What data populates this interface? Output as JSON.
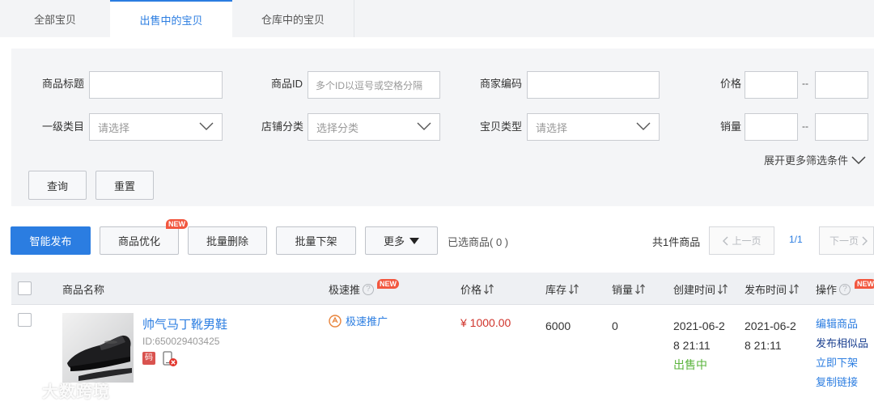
{
  "tabs": [
    {
      "label": "全部宝贝"
    },
    {
      "label": "出售中的宝贝"
    },
    {
      "label": "仓库中的宝贝"
    }
  ],
  "filters": {
    "title_label": "商品标题",
    "id_label": "商品ID",
    "id_placeholder": "多个ID以逗号或空格分隔",
    "merchant_code_label": "商家编码",
    "price_label": "价格",
    "category_label": "一级类目",
    "category_placeholder": "请选择",
    "shop_category_label": "店铺分类",
    "shop_category_placeholder": "选择分类",
    "item_type_label": "宝贝类型",
    "item_type_placeholder": "请选择",
    "sales_label": "销量",
    "range_sep": "--",
    "expand_label": "展开更多筛选条件",
    "query_button": "查询",
    "reset_button": "重置"
  },
  "actions": {
    "smart_publish": "智能发布",
    "optimize": "商品优化",
    "new_badge": "NEW",
    "batch_delete": "批量删除",
    "batch_offline": "批量下架",
    "more": "更多",
    "selected": "已选商品( 0 )",
    "total": "共1件商品",
    "prev": "上一页",
    "page": "1/1",
    "next": "下一页"
  },
  "table": {
    "headers": {
      "name": "商品名称",
      "promo": "极速推",
      "price": "价格",
      "stock": "库存",
      "sales": "销量",
      "created": "创建时间",
      "published": "发布时间",
      "ops": "操作",
      "new_badge": "NEW"
    },
    "rows": [
      {
        "name": "帅气马丁靴男鞋",
        "id": "ID:650029403425",
        "code_tag": "码",
        "promo": "极速推广",
        "price": "¥ 1000.00",
        "stock": "6000",
        "sales": "0",
        "created_line1": "2021-06-2",
        "created_line2": "8 21:11",
        "status": "出售中",
        "published_line1": "2021-06-2",
        "published_line2": "8 21:11",
        "ops": [
          "编辑商品",
          "发布相似品",
          "立即下架",
          "复制链接"
        ]
      }
    ]
  },
  "watermark": "大数跨境",
  "colors": {
    "primary": "#2b7de1",
    "price": "#d0342c",
    "status": "#5ab43c",
    "badge": "#f2573f"
  }
}
